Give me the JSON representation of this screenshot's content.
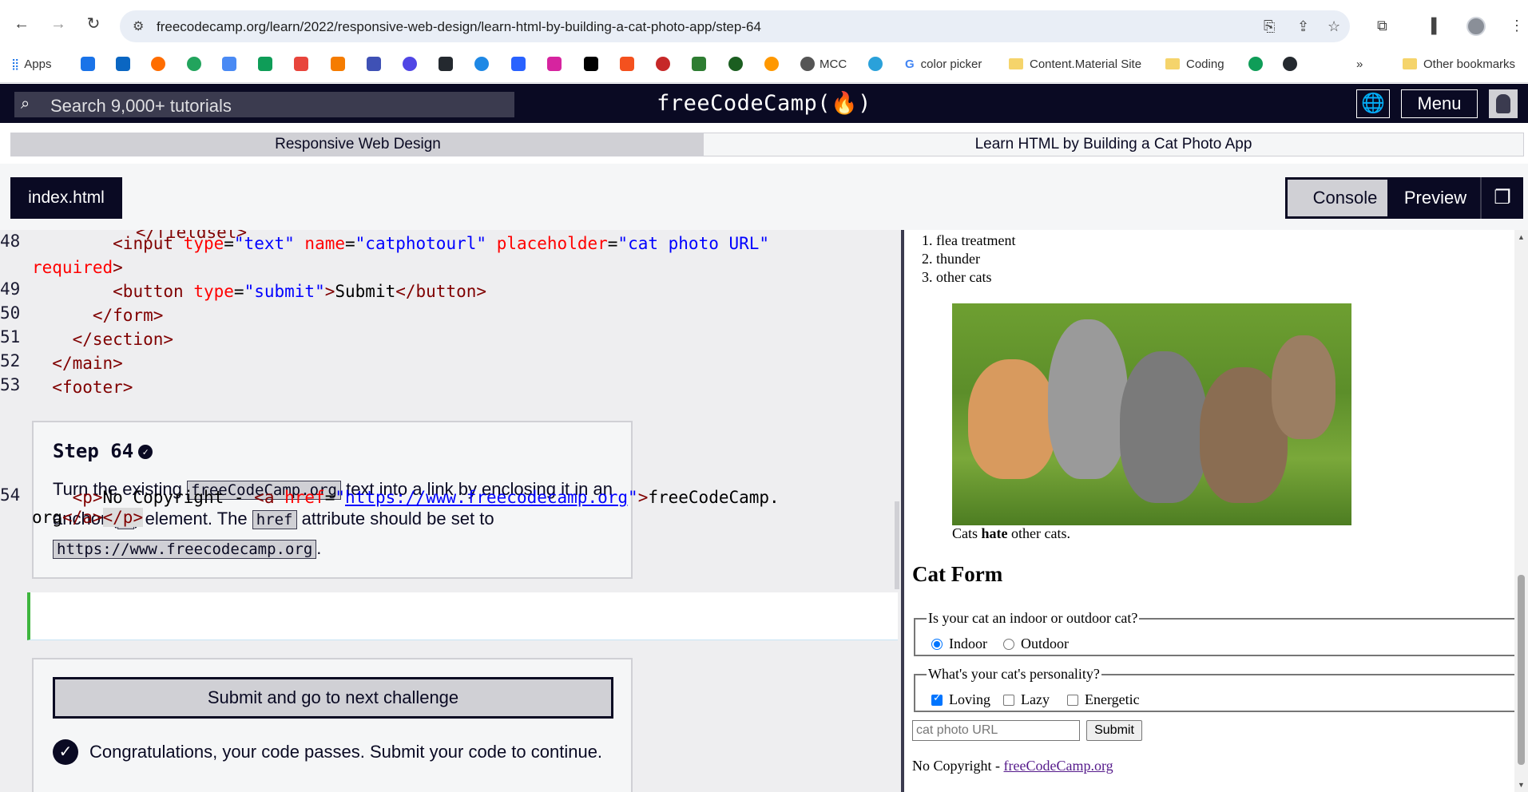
{
  "browser": {
    "url": "freecodecamp.org/learn/2022/responsive-web-design/learn-html-by-building-a-cat-photo-app/step-64",
    "bookmarks": {
      "apps": "Apps",
      "mcc": "MCC",
      "color_picker": "color picker",
      "content_material": "Content.Material Site",
      "coding": "Coding",
      "more": "»",
      "other": "Other bookmarks"
    }
  },
  "fcc": {
    "search_placeholder": "Search 9,000+ tutorials",
    "logo": "freeCodeCamp(🔥)",
    "menu": "Menu",
    "breadcrumb_course": "Responsive Web Design",
    "breadcrumb_project": "Learn HTML by Building a Cat Photo App",
    "file_tab": "index.html",
    "console": "Console",
    "preview": "Preview"
  },
  "editor": {
    "line_numbers": [
      "48",
      "49",
      "50",
      "51",
      "52",
      "53",
      "54"
    ],
    "step_title": "Step 64",
    "step_text_1": "Turn the existing ",
    "step_code_1": "freeCodeCamp.org",
    "step_text_2": " text into a link by enclosing it in an anchor (",
    "step_code_2": "a",
    "step_text_3": ") element. The ",
    "step_code_3": "href",
    "step_text_4": " attribute should be set to ",
    "step_code_4": "https://www.freecodecamp.org",
    "step_text_5": ".",
    "submit_label": "Submit and go to next challenge",
    "pass_message": "Congratulations, your code passes. Submit your code to continue."
  },
  "preview": {
    "list_items": [
      "flea treatment",
      "thunder",
      "other cats"
    ],
    "caption_pre": "Cats ",
    "caption_bold": "hate",
    "caption_post": " other cats.",
    "form_title": "Cat Form",
    "fieldset1_legend": "Is your cat an indoor or outdoor cat?",
    "indoor": "Indoor",
    "outdoor": "Outdoor",
    "fieldset2_legend": "What's your cat's personality?",
    "loving": "Loving",
    "lazy": "Lazy",
    "energetic": "Energetic",
    "url_placeholder": "cat photo URL",
    "submit": "Submit",
    "footer_text": "No Copyright - ",
    "footer_link": "freeCodeCamp.org"
  }
}
